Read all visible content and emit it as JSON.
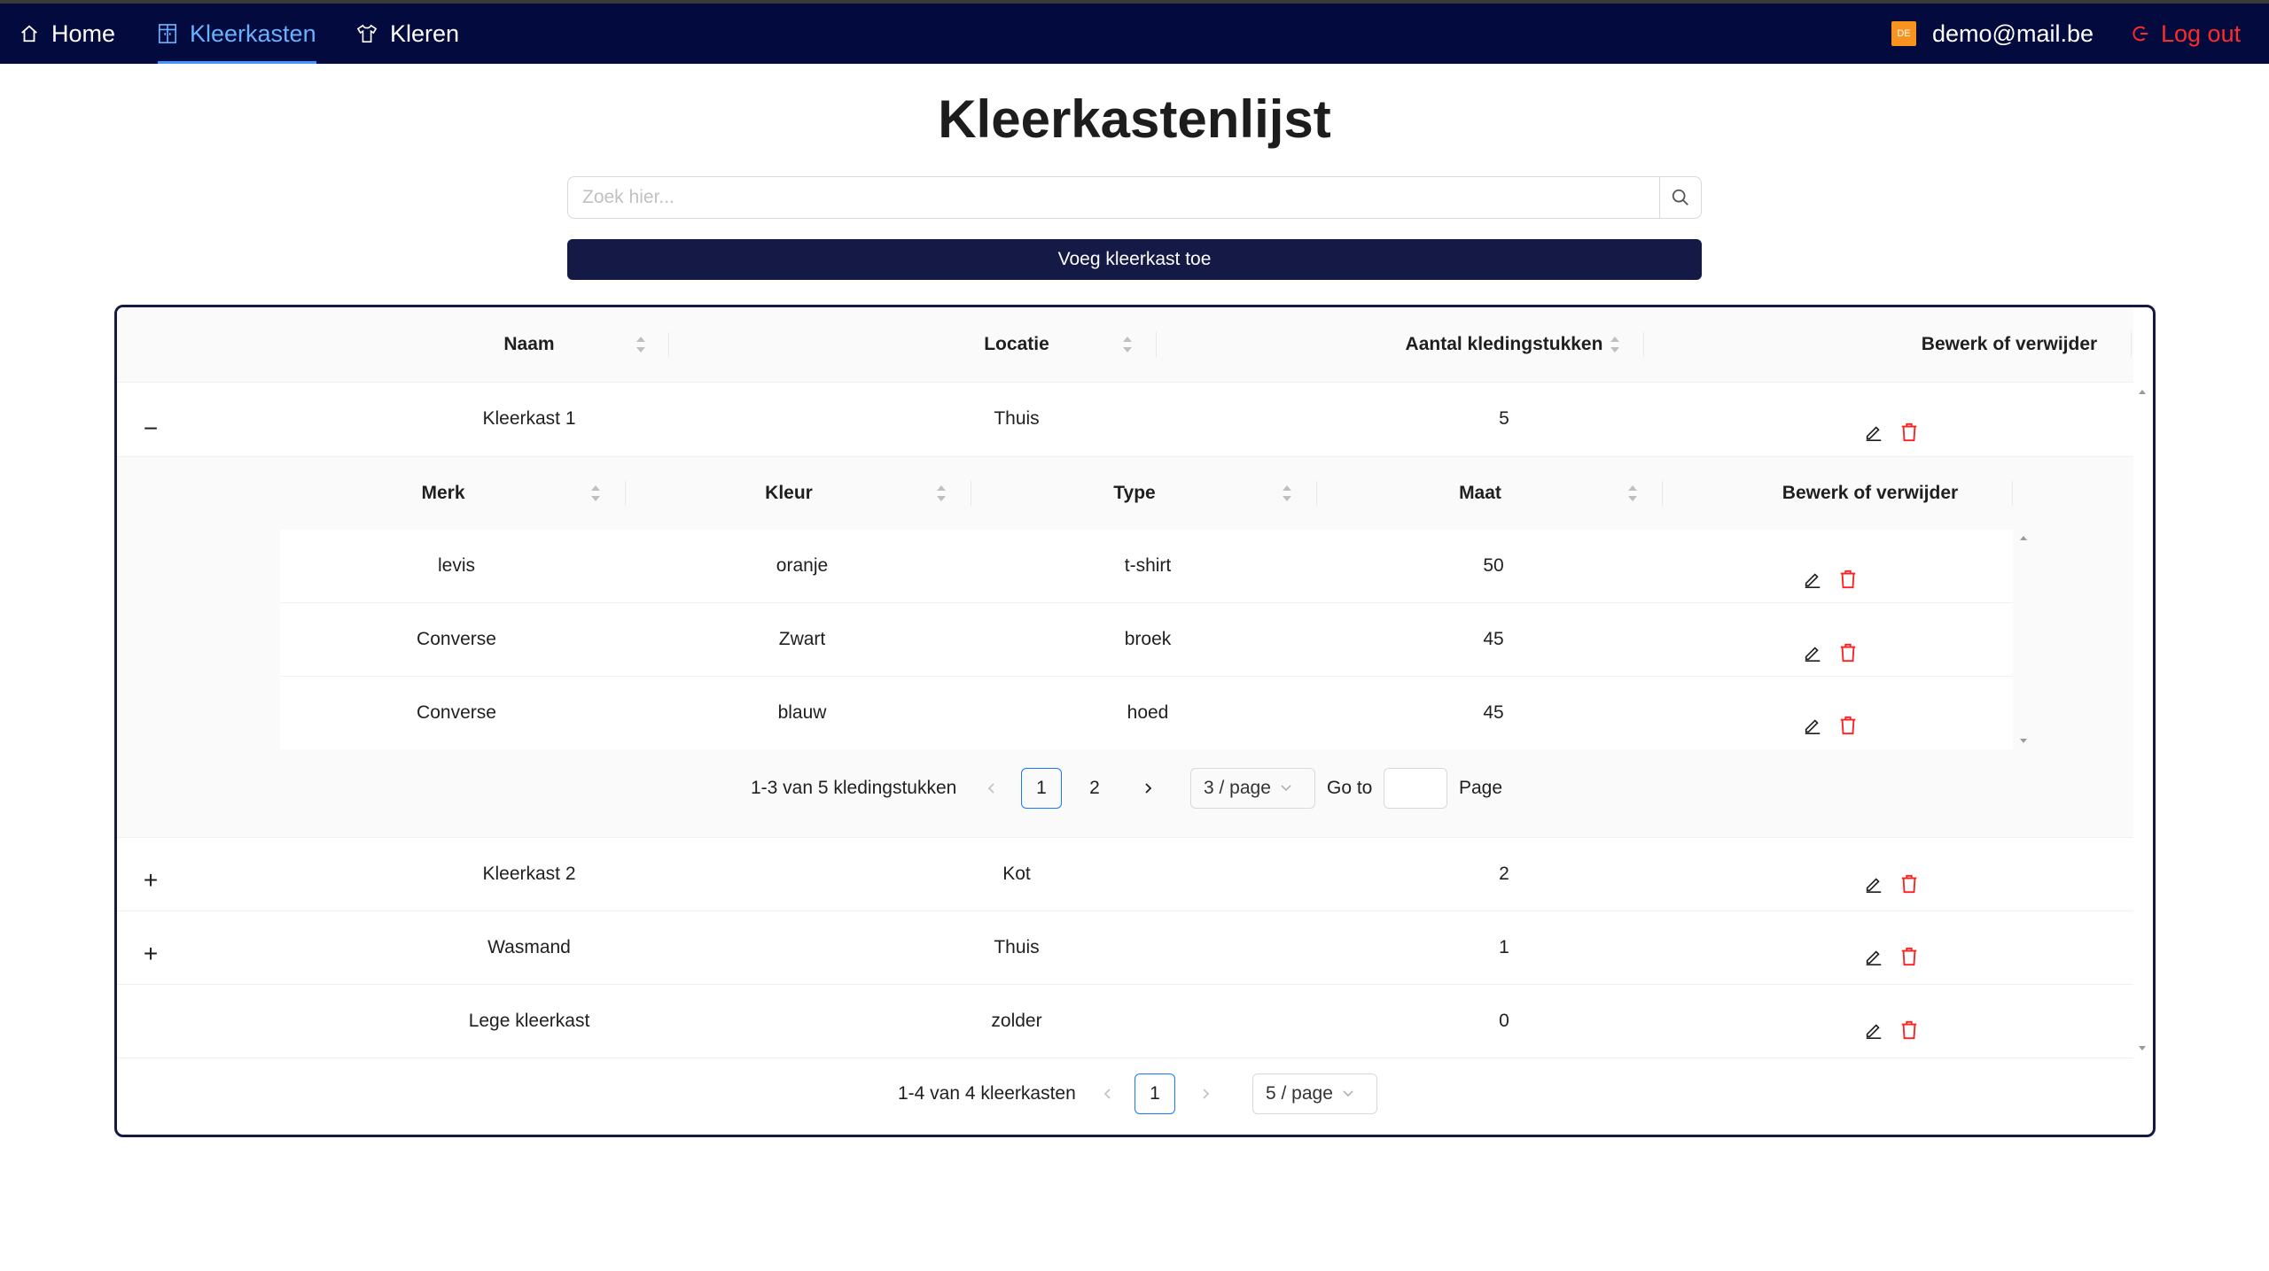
{
  "nav": {
    "home": "Home",
    "wardrobes": "Kleerkasten",
    "clothes": "Kleren",
    "avatar_text": "DE",
    "user_email": "demo@mail.be",
    "logout": "Log out"
  },
  "page": {
    "title": "Kleerkastenlijst",
    "search_placeholder": "Zoek hier...",
    "add_button": "Voeg kleerkast toe"
  },
  "table": {
    "headers": [
      "Naam",
      "Locatie",
      "Aantal kledingstukken",
      "Bewerk of verwijder"
    ],
    "rows": [
      {
        "name": "Kleerkast 1",
        "location": "Thuis",
        "count": "5",
        "expand": "−"
      },
      {
        "name": "Kleerkast 2",
        "location": "Kot",
        "count": "2",
        "expand": "+"
      },
      {
        "name": "Wasmand",
        "location": "Thuis",
        "count": "1",
        "expand": "+"
      },
      {
        "name": "Lege kleerkast",
        "location": "zolder",
        "count": "0",
        "expand": ""
      }
    ],
    "pagination": {
      "summary": "1-4 van 4 kleerkasten",
      "current_page": "1",
      "page_size": "5 / page"
    }
  },
  "subtable": {
    "headers": [
      "Merk",
      "Kleur",
      "Type",
      "Maat",
      "Bewerk of verwijder"
    ],
    "rows": [
      {
        "brand": "levis",
        "color": "oranje",
        "type": "t-shirt",
        "size": "50"
      },
      {
        "brand": "Converse",
        "color": "Zwart",
        "type": "broek",
        "size": "45"
      },
      {
        "brand": "Converse",
        "color": "blauw",
        "type": "hoed",
        "size": "45"
      }
    ],
    "pagination": {
      "summary": "1-3 van 5 kledingstukken",
      "pages": [
        "1",
        "2"
      ],
      "page_size": "3 / page",
      "goto_label": "Go to",
      "page_label": "Page"
    }
  },
  "colors": {
    "navbar": "#030a3d",
    "accent": "#151946",
    "active_nav": "#69b1ff",
    "danger": "#ff2a2a"
  }
}
